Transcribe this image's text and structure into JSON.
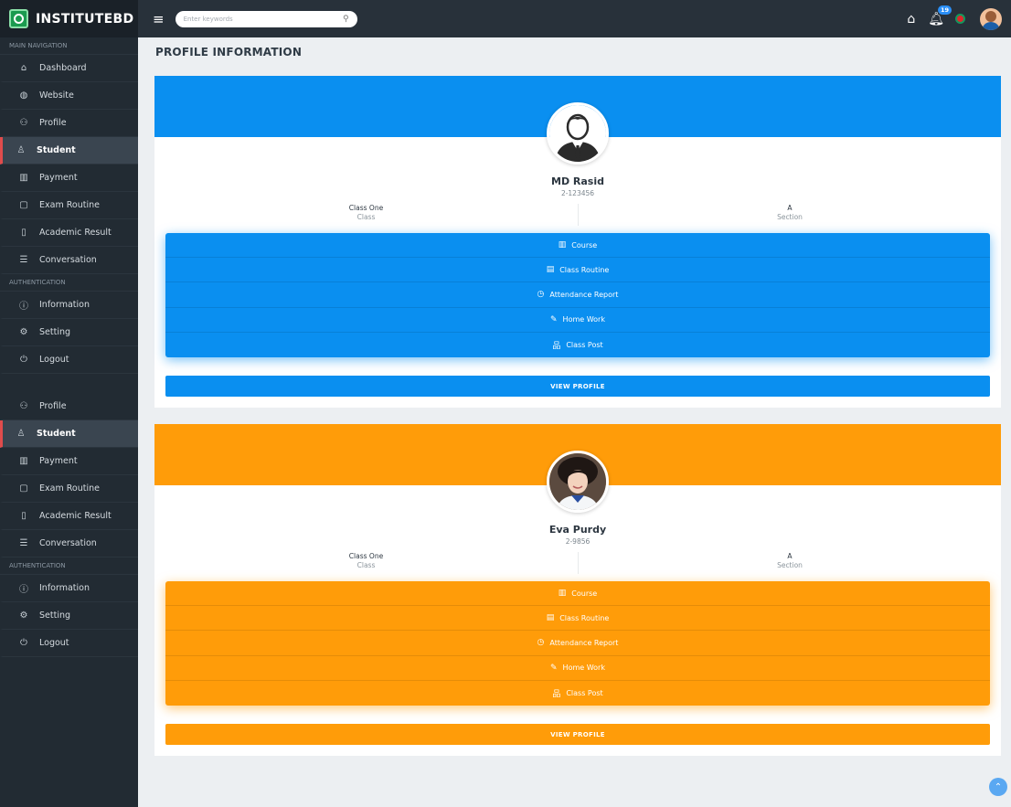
{
  "brand": {
    "name": "INSTITUTEBD"
  },
  "search": {
    "placeholder": "Enter keywords"
  },
  "topbar": {
    "notification_count": "19"
  },
  "sidebar": {
    "section1": {
      "header": "MAIN NAVIGATION",
      "items": [
        {
          "label": "Dashboard",
          "icon": "⌂"
        },
        {
          "label": "Website",
          "icon": "◍"
        },
        {
          "label": "Profile",
          "icon": "⚇"
        },
        {
          "label": "Student",
          "icon": "♙"
        },
        {
          "label": "Payment",
          "icon": "▥"
        },
        {
          "label": "Exam Routine",
          "icon": "▢"
        },
        {
          "label": "Academic Result",
          "icon": "▯"
        },
        {
          "label": "Conversation",
          "icon": "☰"
        }
      ],
      "auth_header": "AUTHENTICATION",
      "auth_items": [
        {
          "label": "Information",
          "icon": "ⓘ"
        },
        {
          "label": "Setting",
          "icon": "⚙"
        },
        {
          "label": "Logout",
          "icon": "⏻"
        }
      ]
    },
    "section2": {
      "items": [
        {
          "label": "Profile",
          "icon": "⚇"
        },
        {
          "label": "Student",
          "icon": "♙"
        },
        {
          "label": "Payment",
          "icon": "▥"
        },
        {
          "label": "Exam Routine",
          "icon": "▢"
        },
        {
          "label": "Academic Result",
          "icon": "▯"
        },
        {
          "label": "Conversation",
          "icon": "☰"
        }
      ],
      "auth_header": "AUTHENTICATION",
      "auth_items": [
        {
          "label": "Information",
          "icon": "ⓘ"
        },
        {
          "label": "Setting",
          "icon": "⚙"
        },
        {
          "label": "Logout",
          "icon": "⏻"
        }
      ]
    }
  },
  "page": {
    "title": "PROFILE INFORMATION"
  },
  "students": [
    {
      "name": "MD Rasid",
      "id": "2-123456",
      "class_value": "Class One",
      "class_label": "Class",
      "section_value": "A",
      "section_label": "Section",
      "theme_color": "#0a8ff0",
      "menu": [
        "Course",
        "Class Routine",
        "Attendance Report",
        "Home Work",
        "Class Post"
      ],
      "view_button": "VIEW PROFILE"
    },
    {
      "name": "Eva Purdy",
      "id": "2-9856",
      "class_value": "Class One",
      "class_label": "Class",
      "section_value": "A",
      "section_label": "Section",
      "theme_color": "#ff9c09",
      "menu": [
        "Course",
        "Class Routine",
        "Attendance Report",
        "Home Work",
        "Class Post"
      ],
      "view_button": "VIEW PROFILE"
    }
  ],
  "menu_icons": [
    "▥",
    "▤",
    "◷",
    "✎",
    "品"
  ]
}
